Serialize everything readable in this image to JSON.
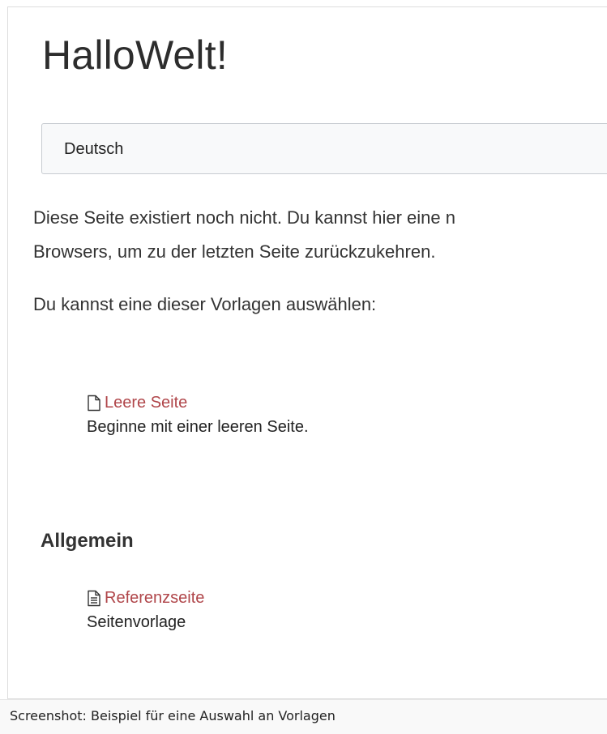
{
  "page": {
    "title": "HalloWelt!",
    "language_select": {
      "value": "Deutsch"
    },
    "paragraph_line1": "Diese Seite existiert noch nicht. Du kannst hier eine n",
    "paragraph_line2": "Browsers, um zu der letzten Seite zurückzukehren.",
    "choose_text": "Du kannst eine dieser Vorlagen auswählen:",
    "templates_empty": [
      {
        "label": "Leere Seite",
        "description": "Beginne mit einer leeren Seite.",
        "icon": "blank-page-icon"
      }
    ],
    "section_general": {
      "heading": "Allgemein",
      "templates": [
        {
          "label": "Referenzseite",
          "description": "Seitenvorlage",
          "icon": "document-lines-icon"
        }
      ]
    }
  },
  "caption": "Screenshot: Beispiel für eine Auswahl an Vorlagen",
  "colors": {
    "link": "#b0464a",
    "select_border": "#c8ccd1",
    "select_bg": "#f8f9fa"
  }
}
